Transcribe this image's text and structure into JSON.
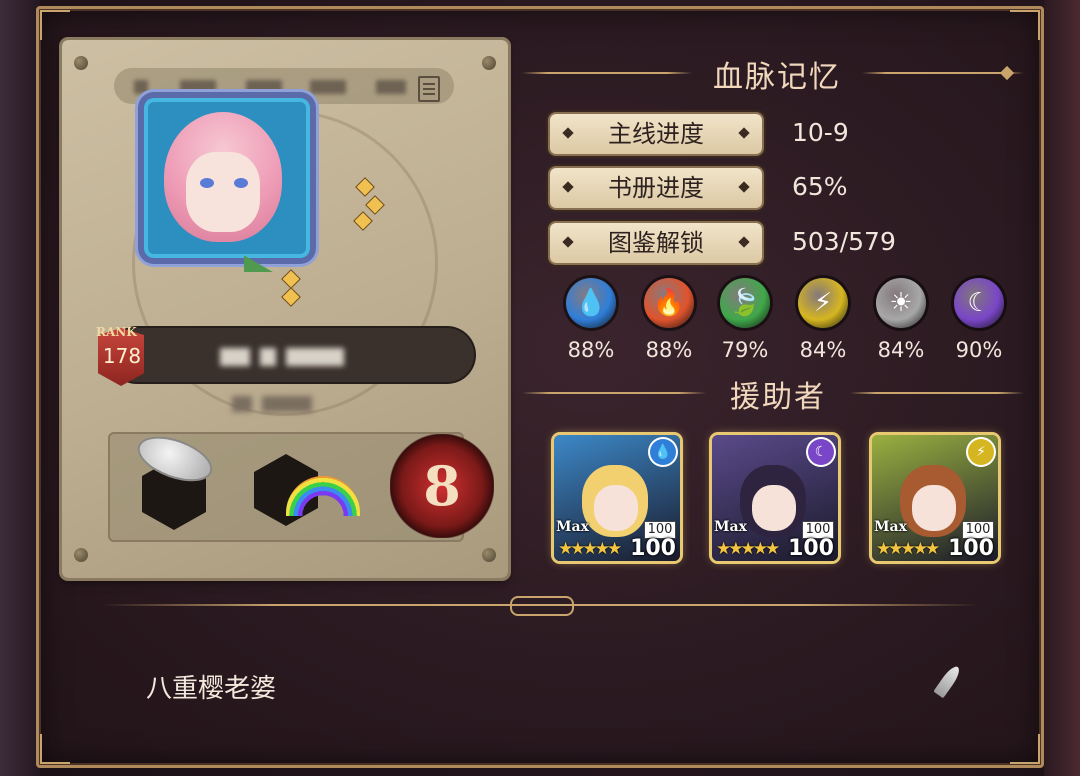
{
  "profile": {
    "rank_label": "RANK",
    "rank_value": "178",
    "signature": "八重樱老婆"
  },
  "memory": {
    "title": "血脉记忆",
    "stats": [
      {
        "label": "主线进度",
        "value": "10-9"
      },
      {
        "label": "书册进度",
        "value": "65%"
      },
      {
        "label": "图鉴解锁",
        "value": "503/579"
      }
    ],
    "elements": [
      {
        "icon": "water-drop-icon",
        "glyph": "💧",
        "pct": "88%",
        "color": "#2f7ed8"
      },
      {
        "icon": "fire-icon",
        "glyph": "🔥",
        "pct": "88%",
        "color": "#e0532c"
      },
      {
        "icon": "leaf-icon",
        "glyph": "🍃",
        "pct": "79%",
        "color": "#3fa84a"
      },
      {
        "icon": "lightning-icon",
        "glyph": "⚡",
        "pct": "84%",
        "color": "#d6b620"
      },
      {
        "icon": "sun-icon",
        "glyph": "☀",
        "pct": "84%",
        "color": "#a8a8a8"
      },
      {
        "icon": "moon-icon",
        "glyph": "☾",
        "pct": "90%",
        "color": "#7a46c8"
      }
    ]
  },
  "helpers": {
    "title": "援助者",
    "items": [
      {
        "element_icon": "water-drop-icon",
        "glyph": "💧",
        "max": "Max",
        "level": "100",
        "stars": "★★★★★",
        "total": "100",
        "bg": "#3c88c8",
        "elem_color": "#2f7ed8",
        "hair": "#f2d070"
      },
      {
        "element_icon": "moon-icon",
        "glyph": "☾",
        "max": "Max",
        "level": "100",
        "stars": "★★★★★",
        "total": "100",
        "bg": "#5a4a8a",
        "elem_color": "#7a46c8",
        "hair": "#2e2440"
      },
      {
        "element_icon": "lightning-icon",
        "glyph": "⚡",
        "max": "Max",
        "level": "100",
        "stars": "★★★★★",
        "total": "100",
        "bg": "#9ab040",
        "elem_color": "#d6b620",
        "hair": "#a85a30"
      }
    ]
  }
}
